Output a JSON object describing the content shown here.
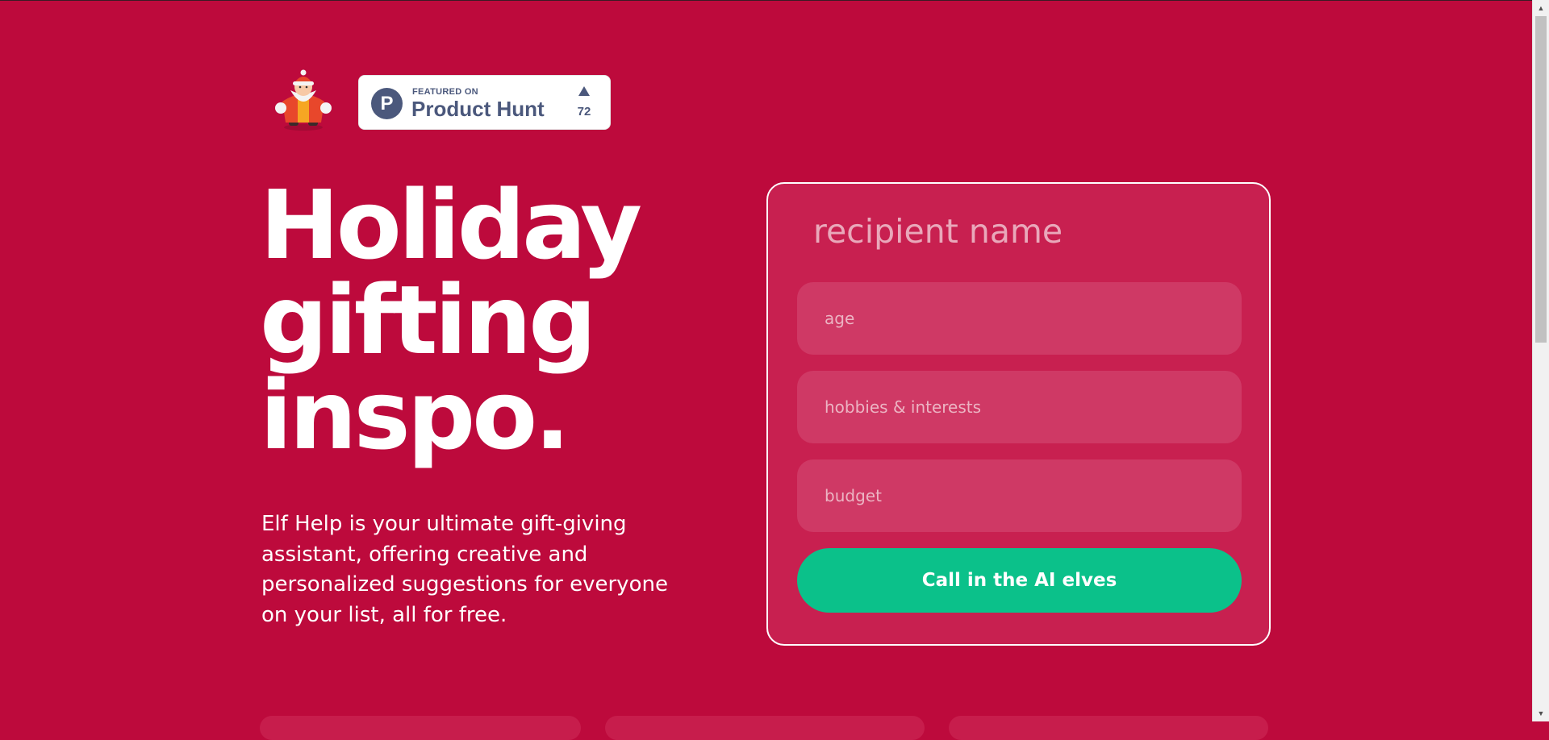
{
  "header": {
    "logo_alt": "Elf Help logo",
    "product_hunt": {
      "featured_label": "FEATURED ON",
      "name": "Product Hunt",
      "letter": "P",
      "upvotes": "72"
    }
  },
  "hero": {
    "title_lines": [
      "Holiday",
      "gifting",
      "inspo."
    ],
    "description": "Elf Help is your ultimate gift-giving assistant, offering creative and personalized suggestions for everyone on your list, all for free."
  },
  "form": {
    "recipient_placeholder": "recipient name",
    "age_placeholder": "age",
    "hobbies_placeholder": "hobbies & interests",
    "budget_placeholder": "budget",
    "submit_label": "Call in the AI elves"
  },
  "colors": {
    "background": "#bd0a3c",
    "card": "#c82050",
    "field": "#cf3965",
    "button": "#0bc18a",
    "product_hunt": "#4b587c"
  },
  "icons": {
    "logo": "elf-santa-icon",
    "upvote": "upvote-arrow-icon",
    "scroll_up": "scroll-up-arrow-icon",
    "scroll_down": "scroll-down-arrow-icon"
  }
}
